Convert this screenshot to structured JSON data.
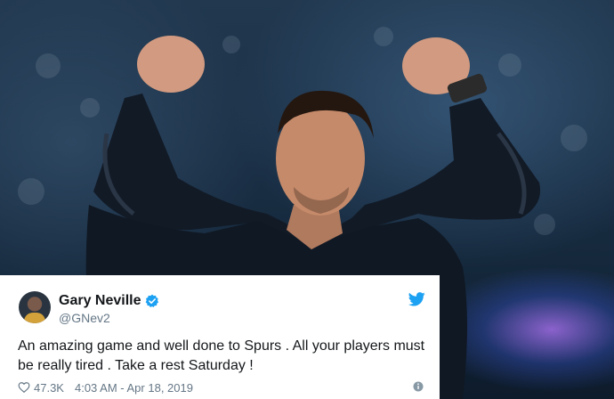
{
  "tweet": {
    "user_name": "Gary Neville",
    "handle": "@GNev2",
    "text": "An amazing game and well done to Spurs . All your players must be really tired . Take a rest Saturday !",
    "likes": "47.3K",
    "timestamp": "4:03 AM - Apr 18, 2019"
  },
  "icons": {
    "verified": "verified-badge-icon",
    "brand": "twitter-bird-icon",
    "like": "heart-icon",
    "info": "info-icon"
  },
  "colors": {
    "verified_blue": "#1da1f2",
    "twitter_blue": "#1da1f2",
    "text_primary": "#14171a",
    "text_secondary": "#657786"
  }
}
